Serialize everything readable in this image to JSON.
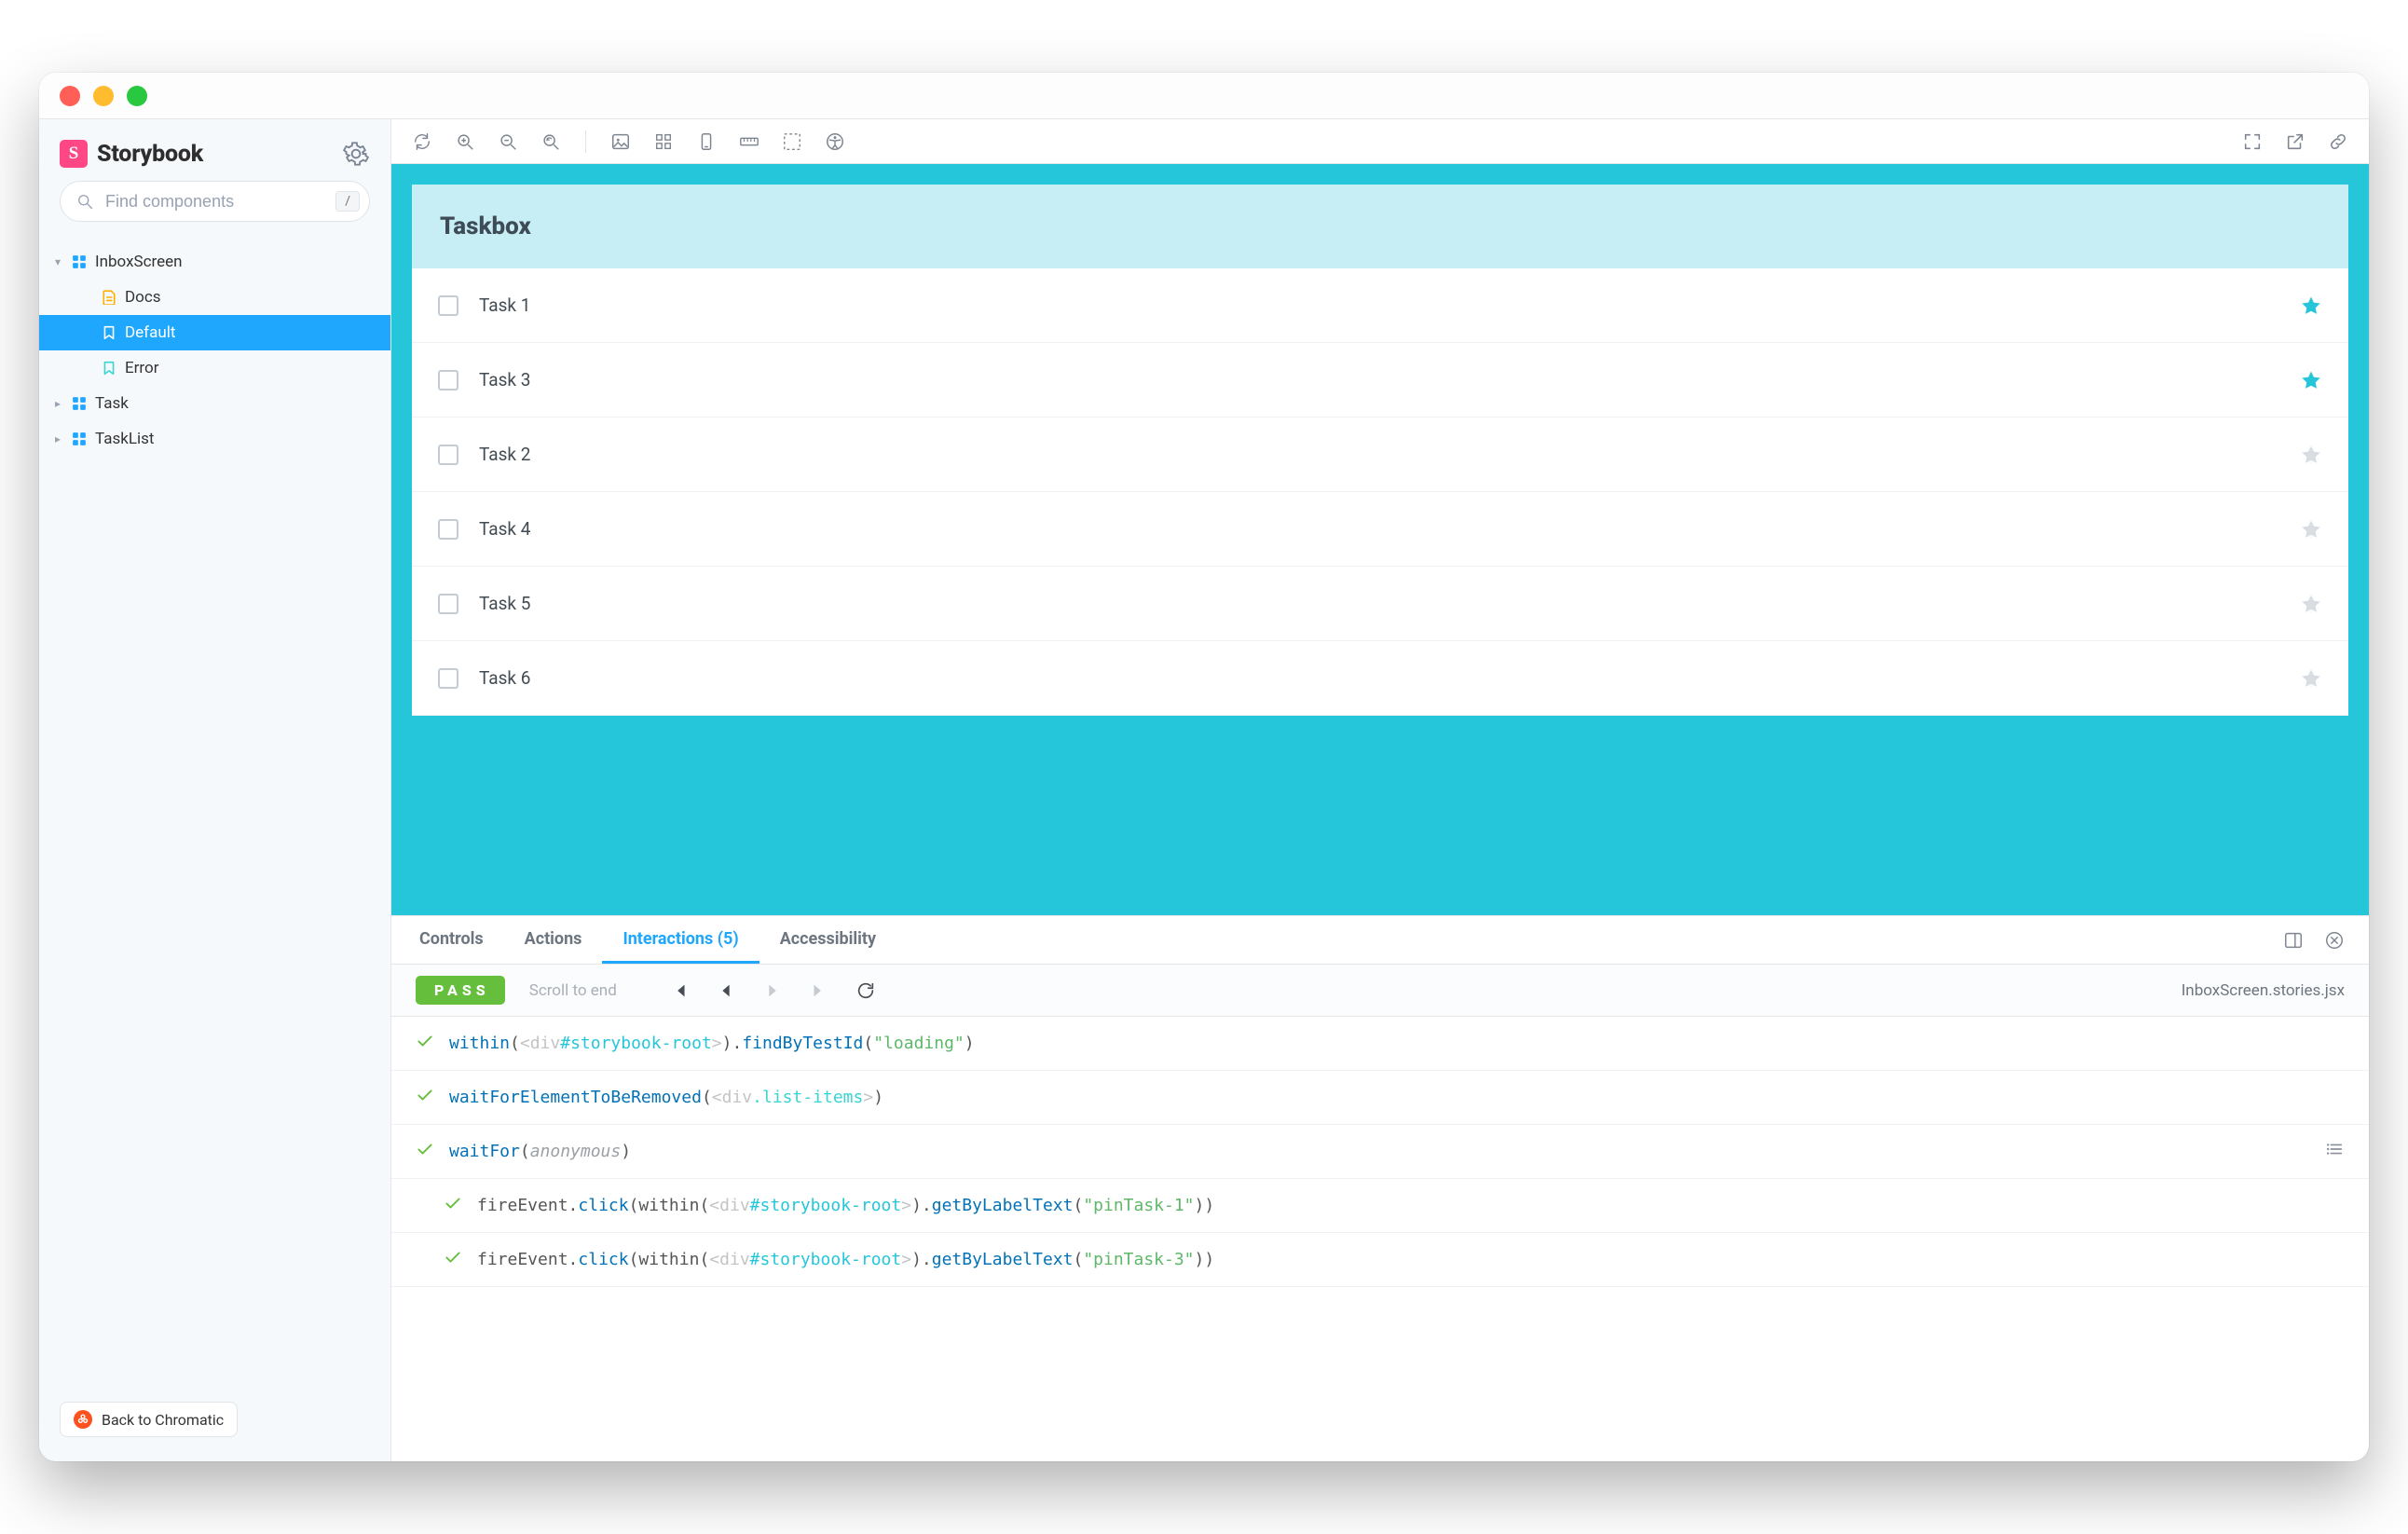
{
  "app_name": "Storybook",
  "search": {
    "placeholder": "Find components",
    "shortcut": "/"
  },
  "tree": {
    "items": [
      {
        "label": "InboxScreen",
        "type": "component",
        "expanded": true
      },
      {
        "label": "Docs",
        "type": "docs"
      },
      {
        "label": "Default",
        "type": "story",
        "selected": true
      },
      {
        "label": "Error",
        "type": "story"
      },
      {
        "label": "Task",
        "type": "component",
        "expanded": false
      },
      {
        "label": "TaskList",
        "type": "component",
        "expanded": false
      }
    ]
  },
  "sidebar_footer": {
    "back_label": "Back to Chromatic"
  },
  "preview": {
    "header": "Taskbox",
    "tasks": [
      {
        "title": "Task 1",
        "pinned": true
      },
      {
        "title": "Task 3",
        "pinned": true
      },
      {
        "title": "Task 2",
        "pinned": false
      },
      {
        "title": "Task 4",
        "pinned": false
      },
      {
        "title": "Task 5",
        "pinned": false
      },
      {
        "title": "Task 6",
        "pinned": false
      }
    ]
  },
  "addons": {
    "tabs": [
      {
        "label": "Controls"
      },
      {
        "label": "Actions"
      },
      {
        "label": "Interactions (5)",
        "active": true
      },
      {
        "label": "Accessibility"
      }
    ],
    "status_badge": "PASS",
    "scroll_label": "Scroll to end",
    "story_file": "InboxScreen.stories.jsx",
    "interactions": [
      {
        "indent": 0,
        "segments": [
          {
            "t": "within",
            "c": "cf"
          },
          {
            "t": "(",
            "c": ""
          },
          {
            "t": "<",
            "c": "cp"
          },
          {
            "t": "div",
            "c": "cp"
          },
          {
            "t": "#storybook-root",
            "c": "ci"
          },
          {
            "t": ">",
            "c": "cp"
          },
          {
            "t": ")",
            "c": ""
          },
          {
            "t": ".",
            "c": ""
          },
          {
            "t": "findByTestId",
            "c": "cf"
          },
          {
            "t": "(",
            "c": ""
          },
          {
            "t": "\"loading\"",
            "c": "cs"
          },
          {
            "t": ")",
            "c": ""
          }
        ]
      },
      {
        "indent": 0,
        "segments": [
          {
            "t": "waitForElementToBeRemoved",
            "c": "cf"
          },
          {
            "t": "(",
            "c": ""
          },
          {
            "t": "<",
            "c": "cp"
          },
          {
            "t": "div",
            "c": "cp"
          },
          {
            "t": ".list-items",
            "c": "cc"
          },
          {
            "t": ">",
            "c": "cp"
          },
          {
            "t": ")",
            "c": ""
          }
        ]
      },
      {
        "indent": 0,
        "expand": true,
        "segments": [
          {
            "t": "waitFor",
            "c": "cf"
          },
          {
            "t": "(",
            "c": ""
          },
          {
            "t": "anonymous",
            "c": "ca"
          },
          {
            "t": ")",
            "c": ""
          }
        ]
      },
      {
        "indent": 1,
        "segments": [
          {
            "t": "fireEvent",
            "c": ""
          },
          {
            "t": ".",
            "c": ""
          },
          {
            "t": "click",
            "c": "cf"
          },
          {
            "t": "(",
            "c": ""
          },
          {
            "t": "within",
            "c": ""
          },
          {
            "t": "(",
            "c": ""
          },
          {
            "t": "<",
            "c": "cp"
          },
          {
            "t": "div",
            "c": "cp"
          },
          {
            "t": "#storybook-root",
            "c": "ci"
          },
          {
            "t": ">",
            "c": "cp"
          },
          {
            "t": ")",
            "c": ""
          },
          {
            "t": ".",
            "c": ""
          },
          {
            "t": "getByLabelText",
            "c": "cf"
          },
          {
            "t": "(",
            "c": ""
          },
          {
            "t": "\"pinTask-1\"",
            "c": "cs"
          },
          {
            "t": ")",
            "c": ""
          },
          {
            "t": ")",
            "c": ""
          }
        ]
      },
      {
        "indent": 1,
        "segments": [
          {
            "t": "fireEvent",
            "c": ""
          },
          {
            "t": ".",
            "c": ""
          },
          {
            "t": "click",
            "c": "cf"
          },
          {
            "t": "(",
            "c": ""
          },
          {
            "t": "within",
            "c": ""
          },
          {
            "t": "(",
            "c": ""
          },
          {
            "t": "<",
            "c": "cp"
          },
          {
            "t": "div",
            "c": "cp"
          },
          {
            "t": "#storybook-root",
            "c": "ci"
          },
          {
            "t": ">",
            "c": "cp"
          },
          {
            "t": ")",
            "c": ""
          },
          {
            "t": ".",
            "c": ""
          },
          {
            "t": "getByLabelText",
            "c": "cf"
          },
          {
            "t": "(",
            "c": ""
          },
          {
            "t": "\"pinTask-3\"",
            "c": "cs"
          },
          {
            "t": ")",
            "c": ""
          },
          {
            "t": ")",
            "c": ""
          }
        ]
      }
    ]
  }
}
